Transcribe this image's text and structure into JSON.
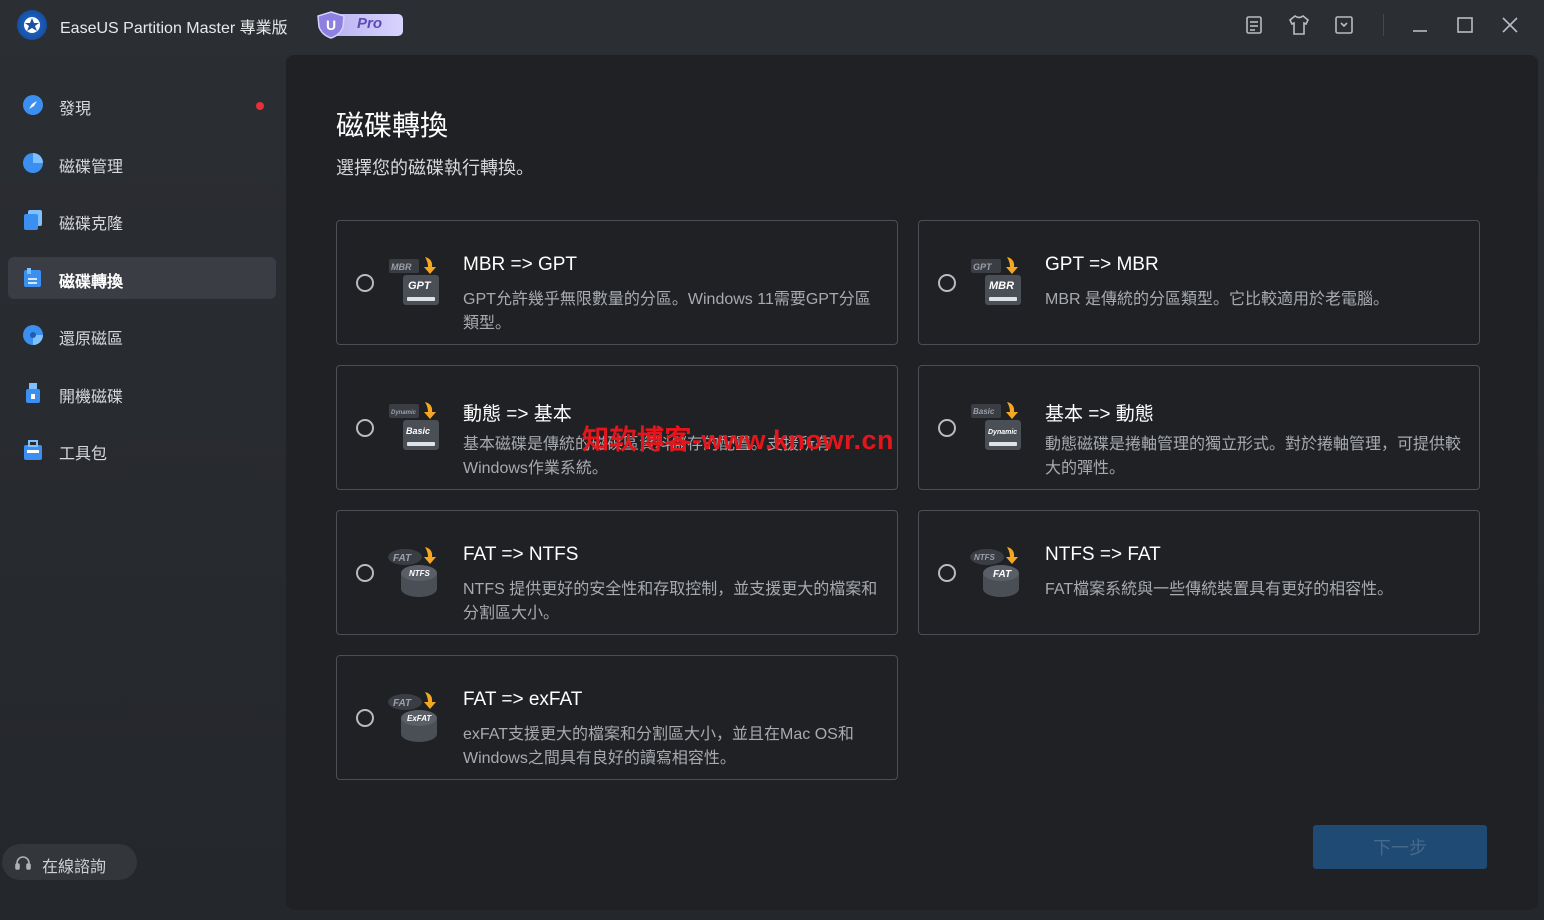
{
  "app": {
    "title": "EaseUS Partition Master 專業版",
    "badge": "Pro",
    "accent_color": "#1f6fd6",
    "window_controls": [
      "notes-icon",
      "shirt-icon",
      "save-icon",
      "minimize-icon",
      "maximize-icon",
      "close-icon"
    ]
  },
  "sidebar": {
    "items": [
      {
        "label": "發現",
        "icon": "compass-icon",
        "has_notification": true
      },
      {
        "label": "磁碟管理",
        "icon": "pie-chart-icon"
      },
      {
        "label": "磁碟克隆",
        "icon": "clone-icon"
      },
      {
        "label": "磁碟轉換",
        "icon": "convert-icon",
        "active": true
      },
      {
        "label": "還原磁區",
        "icon": "recover-icon"
      },
      {
        "label": "開機磁碟",
        "icon": "usb-icon"
      },
      {
        "label": "工具包",
        "icon": "toolbox-icon"
      }
    ],
    "consult": {
      "label": "在線諮詢",
      "icon": "headset-icon"
    }
  },
  "main": {
    "title": "磁碟轉換",
    "subtitle": "選擇您的磁碟執行轉換。",
    "options": [
      {
        "title": "MBR => GPT",
        "desc": "GPT允許幾乎無限數量的分區。Windows 11需要GPT分區類型。",
        "from": "MBR",
        "to": "GPT",
        "icon": "mbr-to-gpt-icon"
      },
      {
        "title": "GPT => MBR",
        "desc": "MBR 是傳統的分區類型。它比較適用於老電腦。",
        "from": "GPT",
        "to": "MBR",
        "icon": "gpt-to-mbr-icon"
      },
      {
        "title": "動態 => 基本",
        "desc": "基本磁碟是傳統的磁碟區資料儲存的配置。支援所有Windows作業系統。",
        "from": "Dynamic",
        "to": "Basic",
        "icon": "dynamic-to-basic-icon"
      },
      {
        "title": "基本 => 動態",
        "desc": "動態磁碟是捲軸管理的獨立形式。對於捲軸管理，可提供較大的彈性。",
        "from": "Basic",
        "to": "Dynamic",
        "icon": "basic-to-dynamic-icon"
      },
      {
        "title": "FAT => NTFS",
        "desc": "NTFS 提供更好的安全性和存取控制，並支援更大的檔案和分割區大小。",
        "from": "FAT",
        "to": "NTFS",
        "icon": "fat-to-ntfs-icon"
      },
      {
        "title": "NTFS => FAT",
        "desc": "FAT檔案系統與一些傳統裝置具有更好的相容性。",
        "from": "NTFS",
        "to": "FAT",
        "icon": "ntfs-to-fat-icon"
      },
      {
        "title": "FAT => exFAT",
        "desc": "exFAT支援更大的檔案和分割區大小，並且在Mac OS和Windows之間具有良好的讀寫相容性。",
        "from": "FAT",
        "to": "ExFAT",
        "icon": "fat-to-exfat-icon"
      }
    ],
    "next_label": "下一步"
  },
  "watermark": "知软博客-www.knowr.cn"
}
